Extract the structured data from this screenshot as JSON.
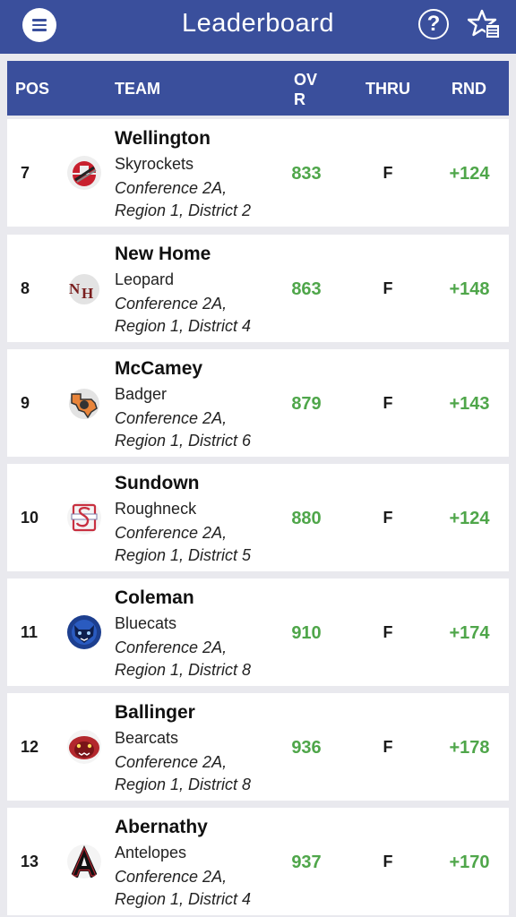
{
  "app": {
    "title": "Leaderboard"
  },
  "header": {
    "icons": {
      "menu": "hamburger-menu-icon",
      "help": "question-circle-icon",
      "favorites": "star-list-icon"
    },
    "help_glyph": "?"
  },
  "table": {
    "columns": {
      "pos": "POS",
      "team": "TEAM",
      "ovr": "OVR",
      "thru": "THRU",
      "rnd": "RND"
    },
    "rows": [
      {
        "pos": "7",
        "name": "Wellington",
        "mascot": "Skyrockets",
        "conf_line1": "Conference 2A,",
        "conf_line2": "Region 1, District 2",
        "ovr": "833",
        "thru": "F",
        "rnd": "+124"
      },
      {
        "pos": "8",
        "name": "New Home",
        "mascot": "Leopard",
        "conf_line1": "Conference 2A,",
        "conf_line2": "Region 1, District 4",
        "ovr": "863",
        "thru": "F",
        "rnd": "+148"
      },
      {
        "pos": "9",
        "name": "McCamey",
        "mascot": "Badger",
        "conf_line1": "Conference 2A,",
        "conf_line2": "Region 1, District 6",
        "ovr": "879",
        "thru": "F",
        "rnd": "+143"
      },
      {
        "pos": "10",
        "name": "Sundown",
        "mascot": "Roughneck",
        "conf_line1": "Conference 2A,",
        "conf_line2": "Region 1, District 5",
        "ovr": "880",
        "thru": "F",
        "rnd": "+124"
      },
      {
        "pos": "11",
        "name": "Coleman",
        "mascot": "Bluecats",
        "conf_line1": "Conference 2A,",
        "conf_line2": "Region 1, District 8",
        "ovr": "910",
        "thru": "F",
        "rnd": "+174"
      },
      {
        "pos": "12",
        "name": "Ballinger",
        "mascot": "Bearcats",
        "conf_line1": "Conference 2A,",
        "conf_line2": "Region 1, District 8",
        "ovr": "936",
        "thru": "F",
        "rnd": "+178"
      },
      {
        "pos": "13",
        "name": "Abernathy",
        "mascot": "Antelopes",
        "conf_line1": "Conference 2A,",
        "conf_line2": "Region 1, District 4",
        "ovr": "937",
        "thru": "F",
        "rnd": "+170"
      }
    ]
  },
  "colors": {
    "brand": "#3a4f9c",
    "score_green": "#4fa64a",
    "background": "#e9e9ee"
  }
}
